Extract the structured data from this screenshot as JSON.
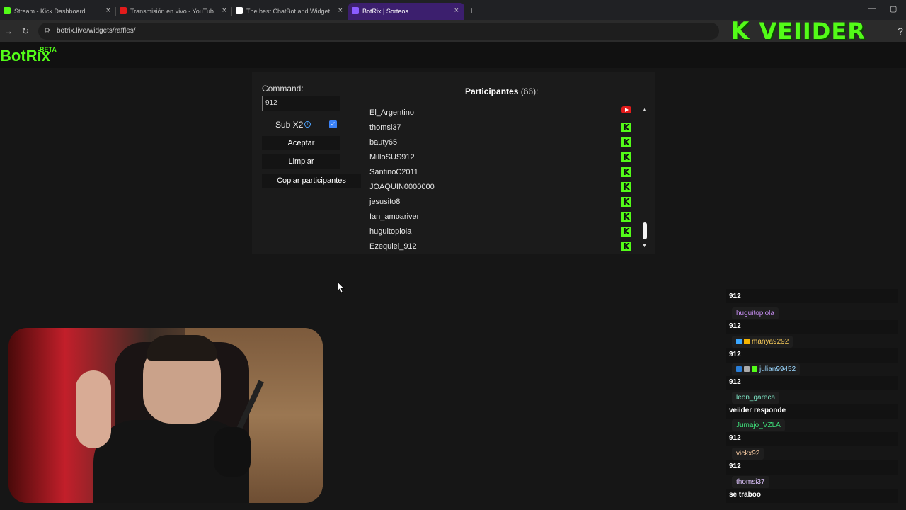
{
  "browser": {
    "tabs": [
      {
        "title": "Stream - Kick Dashboard",
        "favicon_color": "#53fc18",
        "active": false
      },
      {
        "title": "Transmisión en vivo - YouTube",
        "favicon_color": "#e21b1b",
        "active": false
      },
      {
        "title": "The best ChatBot and Widgets",
        "favicon_color": "#ffffff",
        "active": false
      },
      {
        "title": "BotRix | Sorteos",
        "favicon_color": "#8a5cff",
        "active": true
      }
    ],
    "new_tab_icon": "+",
    "url": "botrix.live/widgets/raffles/"
  },
  "overlay": {
    "k_logo": "K",
    "streamer_name": "VEIIDER"
  },
  "app": {
    "brand": "BotRix",
    "beta": "BETA"
  },
  "widget": {
    "command_label": "Command:",
    "command_value": "912",
    "sub_label": "Sub X2",
    "sub_checked": true,
    "buttons": {
      "accept": "Aceptar",
      "clear": "Limpiar",
      "copy": "Copiar participantes"
    },
    "participants_title": "Participantes",
    "participants_count": "(66):",
    "participants": [
      {
        "name": "El_Argentino",
        "platform": "youtube"
      },
      {
        "name": "thomsi37",
        "platform": "kick"
      },
      {
        "name": "bauty65",
        "platform": "kick"
      },
      {
        "name": "MilloSUS912",
        "platform": "kick"
      },
      {
        "name": "SantinoC2011",
        "platform": "kick"
      },
      {
        "name": "JOAQUIN0000000",
        "platform": "kick"
      },
      {
        "name": "jesusito8",
        "platform": "kick"
      },
      {
        "name": "Ian_amoariver",
        "platform": "kick"
      },
      {
        "name": "huguitopiola",
        "platform": "kick"
      },
      {
        "name": "Ezequiel_912",
        "platform": "kick"
      }
    ]
  },
  "chat": {
    "top_text": "912",
    "messages": [
      {
        "user": "huguitopiola",
        "color": "#c58cf0",
        "text": "912",
        "badges": []
      },
      {
        "user": "manya9292",
        "color": "#ffd15c",
        "text": "912",
        "badges": [
          "#3ba7ff",
          "#f5b400"
        ]
      },
      {
        "user": "julian99452",
        "color": "#9ad7ff",
        "text": "912",
        "badges": [
          "#2a7ed8",
          "#aaaaaa",
          "#53fc18"
        ]
      },
      {
        "user": "leon_gareca",
        "color": "#7ee7c7",
        "text": "veiider responde",
        "badges": []
      },
      {
        "user": "Jumajo_VZLA",
        "color": "#3ee07a",
        "text": "912",
        "badges": []
      },
      {
        "user": "vickx92",
        "color": "#f7c9a0",
        "text": "912",
        "badges": []
      },
      {
        "user": "thomsi37",
        "color": "#e0c6ff",
        "text": "se traboo",
        "badges": []
      }
    ]
  }
}
